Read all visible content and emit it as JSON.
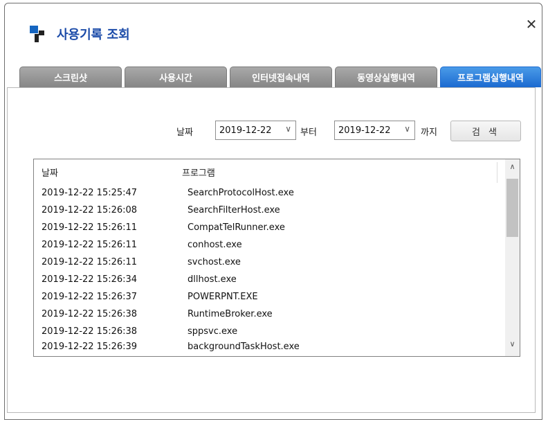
{
  "window": {
    "title": "사용기록 조회",
    "close_label": "✕"
  },
  "tabs": [
    {
      "label": "스크린샷"
    },
    {
      "label": "사용시간"
    },
    {
      "label": "인터넷접속내역"
    },
    {
      "label": "동영상실행내역"
    },
    {
      "label": "프로그램실행내역"
    }
  ],
  "active_tab": 4,
  "filter": {
    "date_label": "날짜",
    "from_value": "2019-12-22",
    "from_suffix": "부터",
    "to_value": "2019-12-22",
    "to_suffix": "까지",
    "search_label": "검 색"
  },
  "table": {
    "columns": [
      "날짜",
      "프로그램"
    ],
    "rows": [
      [
        "2019-12-22 15:25:47",
        "SearchProtocolHost.exe"
      ],
      [
        "2019-12-22 15:26:08",
        "SearchFilterHost.exe"
      ],
      [
        "2019-12-22 15:26:11",
        "CompatTelRunner.exe"
      ],
      [
        "2019-12-22 15:26:11",
        "conhost.exe"
      ],
      [
        "2019-12-22 15:26:11",
        "svchost.exe"
      ],
      [
        "2019-12-22 15:26:34",
        "dllhost.exe"
      ],
      [
        "2019-12-22 15:26:37",
        "POWERPNT.EXE"
      ],
      [
        "2019-12-22 15:26:38",
        "RuntimeBroker.exe"
      ],
      [
        "2019-12-22 15:26:38",
        "sppsvc.exe"
      ],
      [
        "2019-12-22 15:26:39",
        "backgroundTaskHost.exe"
      ]
    ]
  },
  "colors": {
    "accent": "#1b6ad0",
    "title": "#1a4aa8",
    "tab_inactive": "#8c8c8c"
  }
}
